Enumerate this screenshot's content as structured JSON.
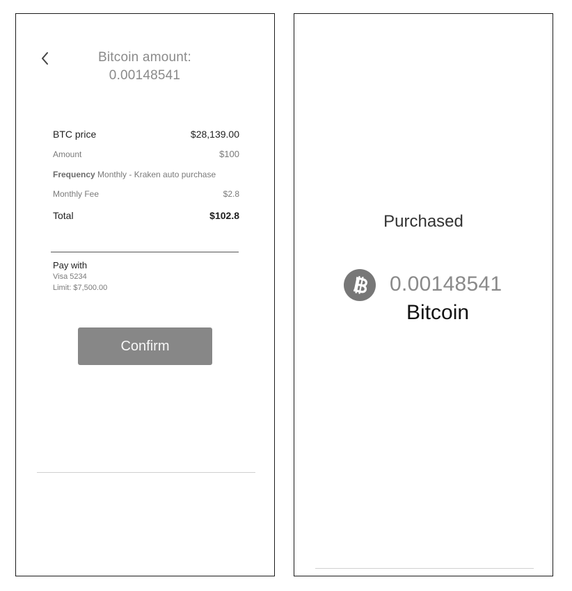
{
  "confirm_screen": {
    "title_line1": "Bitcoin amount:",
    "title_line2": "0.00148541",
    "details": {
      "btc_price_label": "BTC price",
      "btc_price_value": "$28,139.00",
      "amount_label": "Amount",
      "amount_value": "$100",
      "frequency_label": "Frequency",
      "frequency_value": " Monthly -  Kraken auto purchase",
      "fee_label": "Monthly Fee",
      "fee_value": "$2.8",
      "total_label": "Total",
      "total_value": "$102.8"
    },
    "pay_with": {
      "heading": "Pay with",
      "card": "Visa 5234",
      "limit": "Limit: $7,500.00"
    },
    "confirm_label": "Confirm"
  },
  "success_screen": {
    "heading": "Purchased",
    "amount": "0.00148541",
    "coin_name": "Bitcoin",
    "coin_icon": "bitcoin-icon"
  },
  "colors": {
    "button_bg": "#878787",
    "icon_bg": "#777777",
    "muted_text": "#8a8a8a"
  }
}
